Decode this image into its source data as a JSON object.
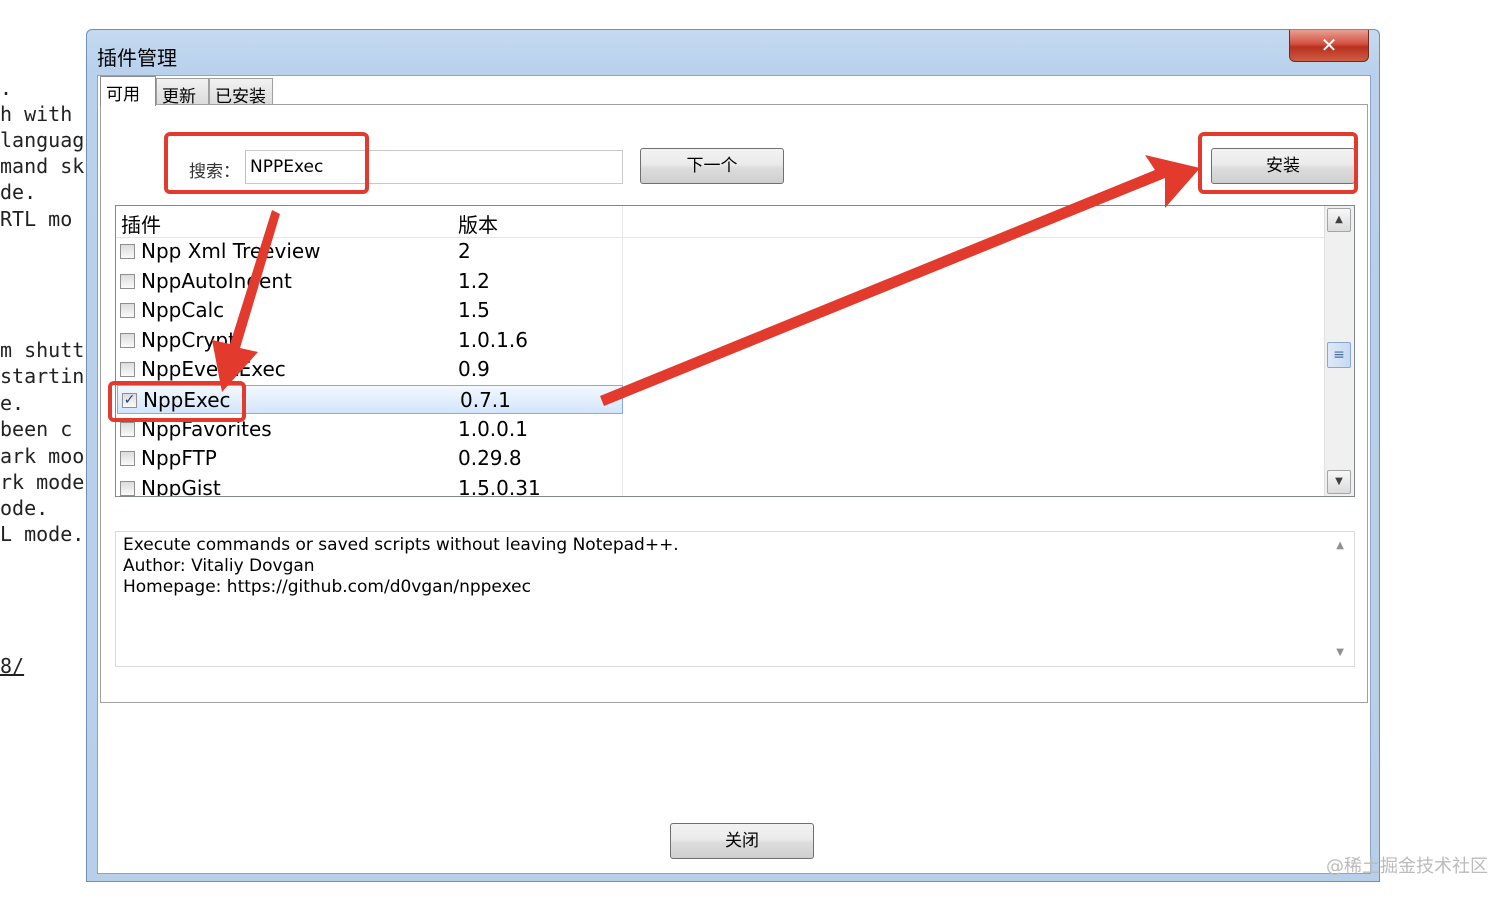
{
  "background_editor": {
    "lines": [
      ".",
      "h with",
      "languag",
      "mand sk",
      "de.",
      " RTL mo",
      "m shutt",
      "startin",
      "e.",
      " been c",
      "ark moo",
      "rk mode",
      "ode.",
      "L mode.",
      "8/"
    ]
  },
  "dialog": {
    "title": "插件管理",
    "close_glyph": "✕",
    "tabs": [
      {
        "label": "可用",
        "active": true
      },
      {
        "label": "更新",
        "active": false
      },
      {
        "label": "已安装",
        "active": false
      }
    ],
    "search": {
      "label": "搜索：",
      "value": "NPPExec"
    },
    "next_button": "下一个",
    "install_button": "安装",
    "list": {
      "columns": [
        "插件",
        "版本"
      ],
      "rows": [
        {
          "name": "Npp Xml Treeview",
          "version": "2",
          "checked": false
        },
        {
          "name": "NppAutoIndent",
          "version": "1.2",
          "checked": false
        },
        {
          "name": "NppCalc",
          "version": "1.5",
          "checked": false
        },
        {
          "name": "NppCrypt",
          "version": "1.0.1.6",
          "checked": false
        },
        {
          "name": "NppEventExec",
          "version": "0.9",
          "checked": false
        },
        {
          "name": "NppExec",
          "version": "0.7.1",
          "checked": true,
          "selected": true
        },
        {
          "name": "NppFavorites",
          "version": "1.0.0.1",
          "checked": false
        },
        {
          "name": "NppFTP",
          "version": "0.29.8",
          "checked": false
        },
        {
          "name": "NppGist",
          "version": "1.5.0.31",
          "checked": false
        }
      ],
      "scroll_up": "▲",
      "scroll_down": "▼",
      "scroll_thumb": "≡"
    },
    "description": {
      "lines": [
        "Execute commands or saved scripts without leaving Notepad++.",
        "Author: Vitaliy Dovgan",
        "Homepage: https://github.com/d0vgan/nppexec"
      ],
      "scroll_up": "▲",
      "scroll_down": "▼"
    },
    "close_button": "关闭"
  },
  "annotation_color": "#e23a2d",
  "watermark": "@稀土掘金技术社区"
}
